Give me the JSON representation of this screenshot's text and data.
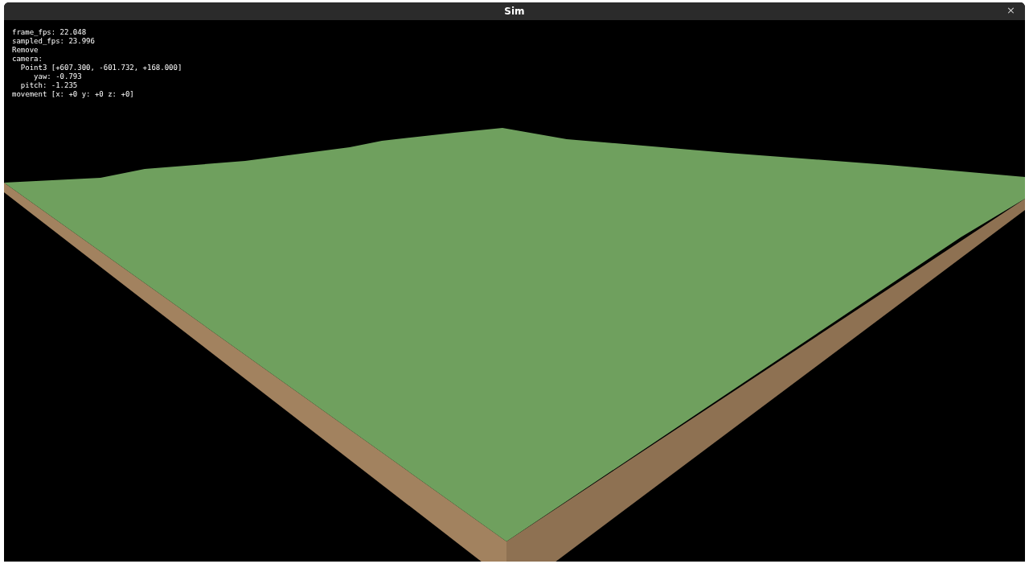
{
  "window": {
    "title": "Sim",
    "close": "×"
  },
  "overlay": {
    "lines": [
      "frame_fps: 22.048",
      "sampled_fps: 23.996",
      "Remove",
      "camera:",
      "  Point3 [+607.300, -601.732, +168.000]",
      "     yaw: -0.793",
      "  pitch: -1.235",
      "movement [x: +0 y: +0 z: +0]"
    ]
  }
}
